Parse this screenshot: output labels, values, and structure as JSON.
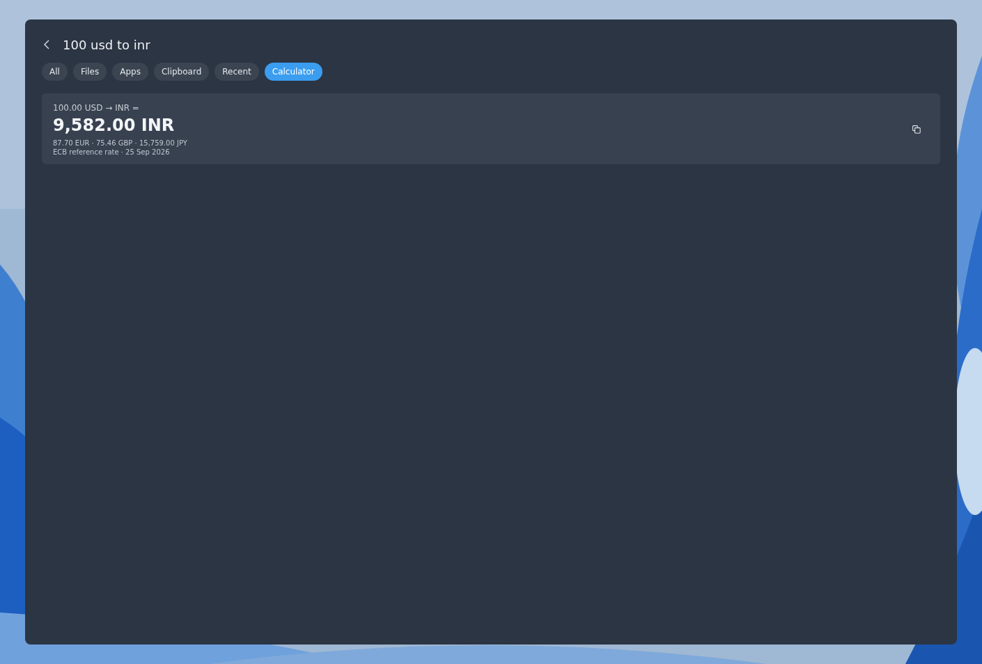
{
  "search": {
    "value": "100 usd to inr"
  },
  "filters": [
    {
      "label": "All",
      "selected": false
    },
    {
      "label": "Files",
      "selected": false
    },
    {
      "label": "Apps",
      "selected": false
    },
    {
      "label": "Clipboard",
      "selected": false
    },
    {
      "label": "Recent",
      "selected": false
    },
    {
      "label": "Calculator",
      "selected": true
    }
  ],
  "result": {
    "expression": "100.00 USD → INR =",
    "answer": "9,582.00 INR",
    "other_currencies": "87.70 EUR · 75.46 GBP · 15,759.00 JPY",
    "source": "ECB reference rate · 25 Sep 2026"
  }
}
